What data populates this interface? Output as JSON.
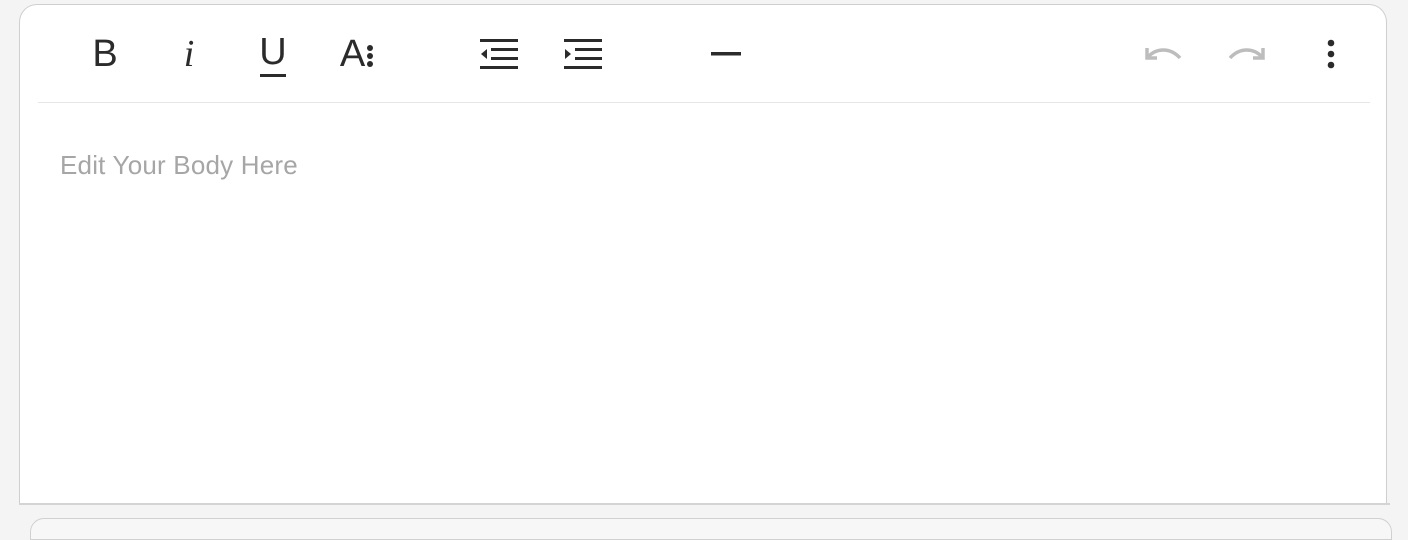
{
  "toolbar": {
    "bold": {
      "label": "B",
      "icon": "bold-icon"
    },
    "italic": {
      "label": "i",
      "icon": "italic-icon"
    },
    "underline": {
      "label": "U",
      "icon": "underline-icon"
    },
    "font_size": {
      "label": "A",
      "icon": "font-size-icon"
    },
    "outdent": {
      "icon": "outdent-icon"
    },
    "indent": {
      "icon": "indent-icon"
    },
    "horizontal_rule": {
      "icon": "horizontal-rule-icon"
    },
    "undo": {
      "icon": "undo-icon",
      "state": "disabled"
    },
    "redo": {
      "icon": "redo-icon",
      "state": "disabled"
    },
    "more": {
      "icon": "more-vertical-icon"
    }
  },
  "editor": {
    "placeholder": "Edit Your Body Here"
  },
  "colors": {
    "icon_active": "#2b2b2b",
    "icon_disabled": "#bdbdbd",
    "placeholder": "#a6a6a6",
    "border": "#cfcfcf",
    "background": "#f4f4f4"
  }
}
